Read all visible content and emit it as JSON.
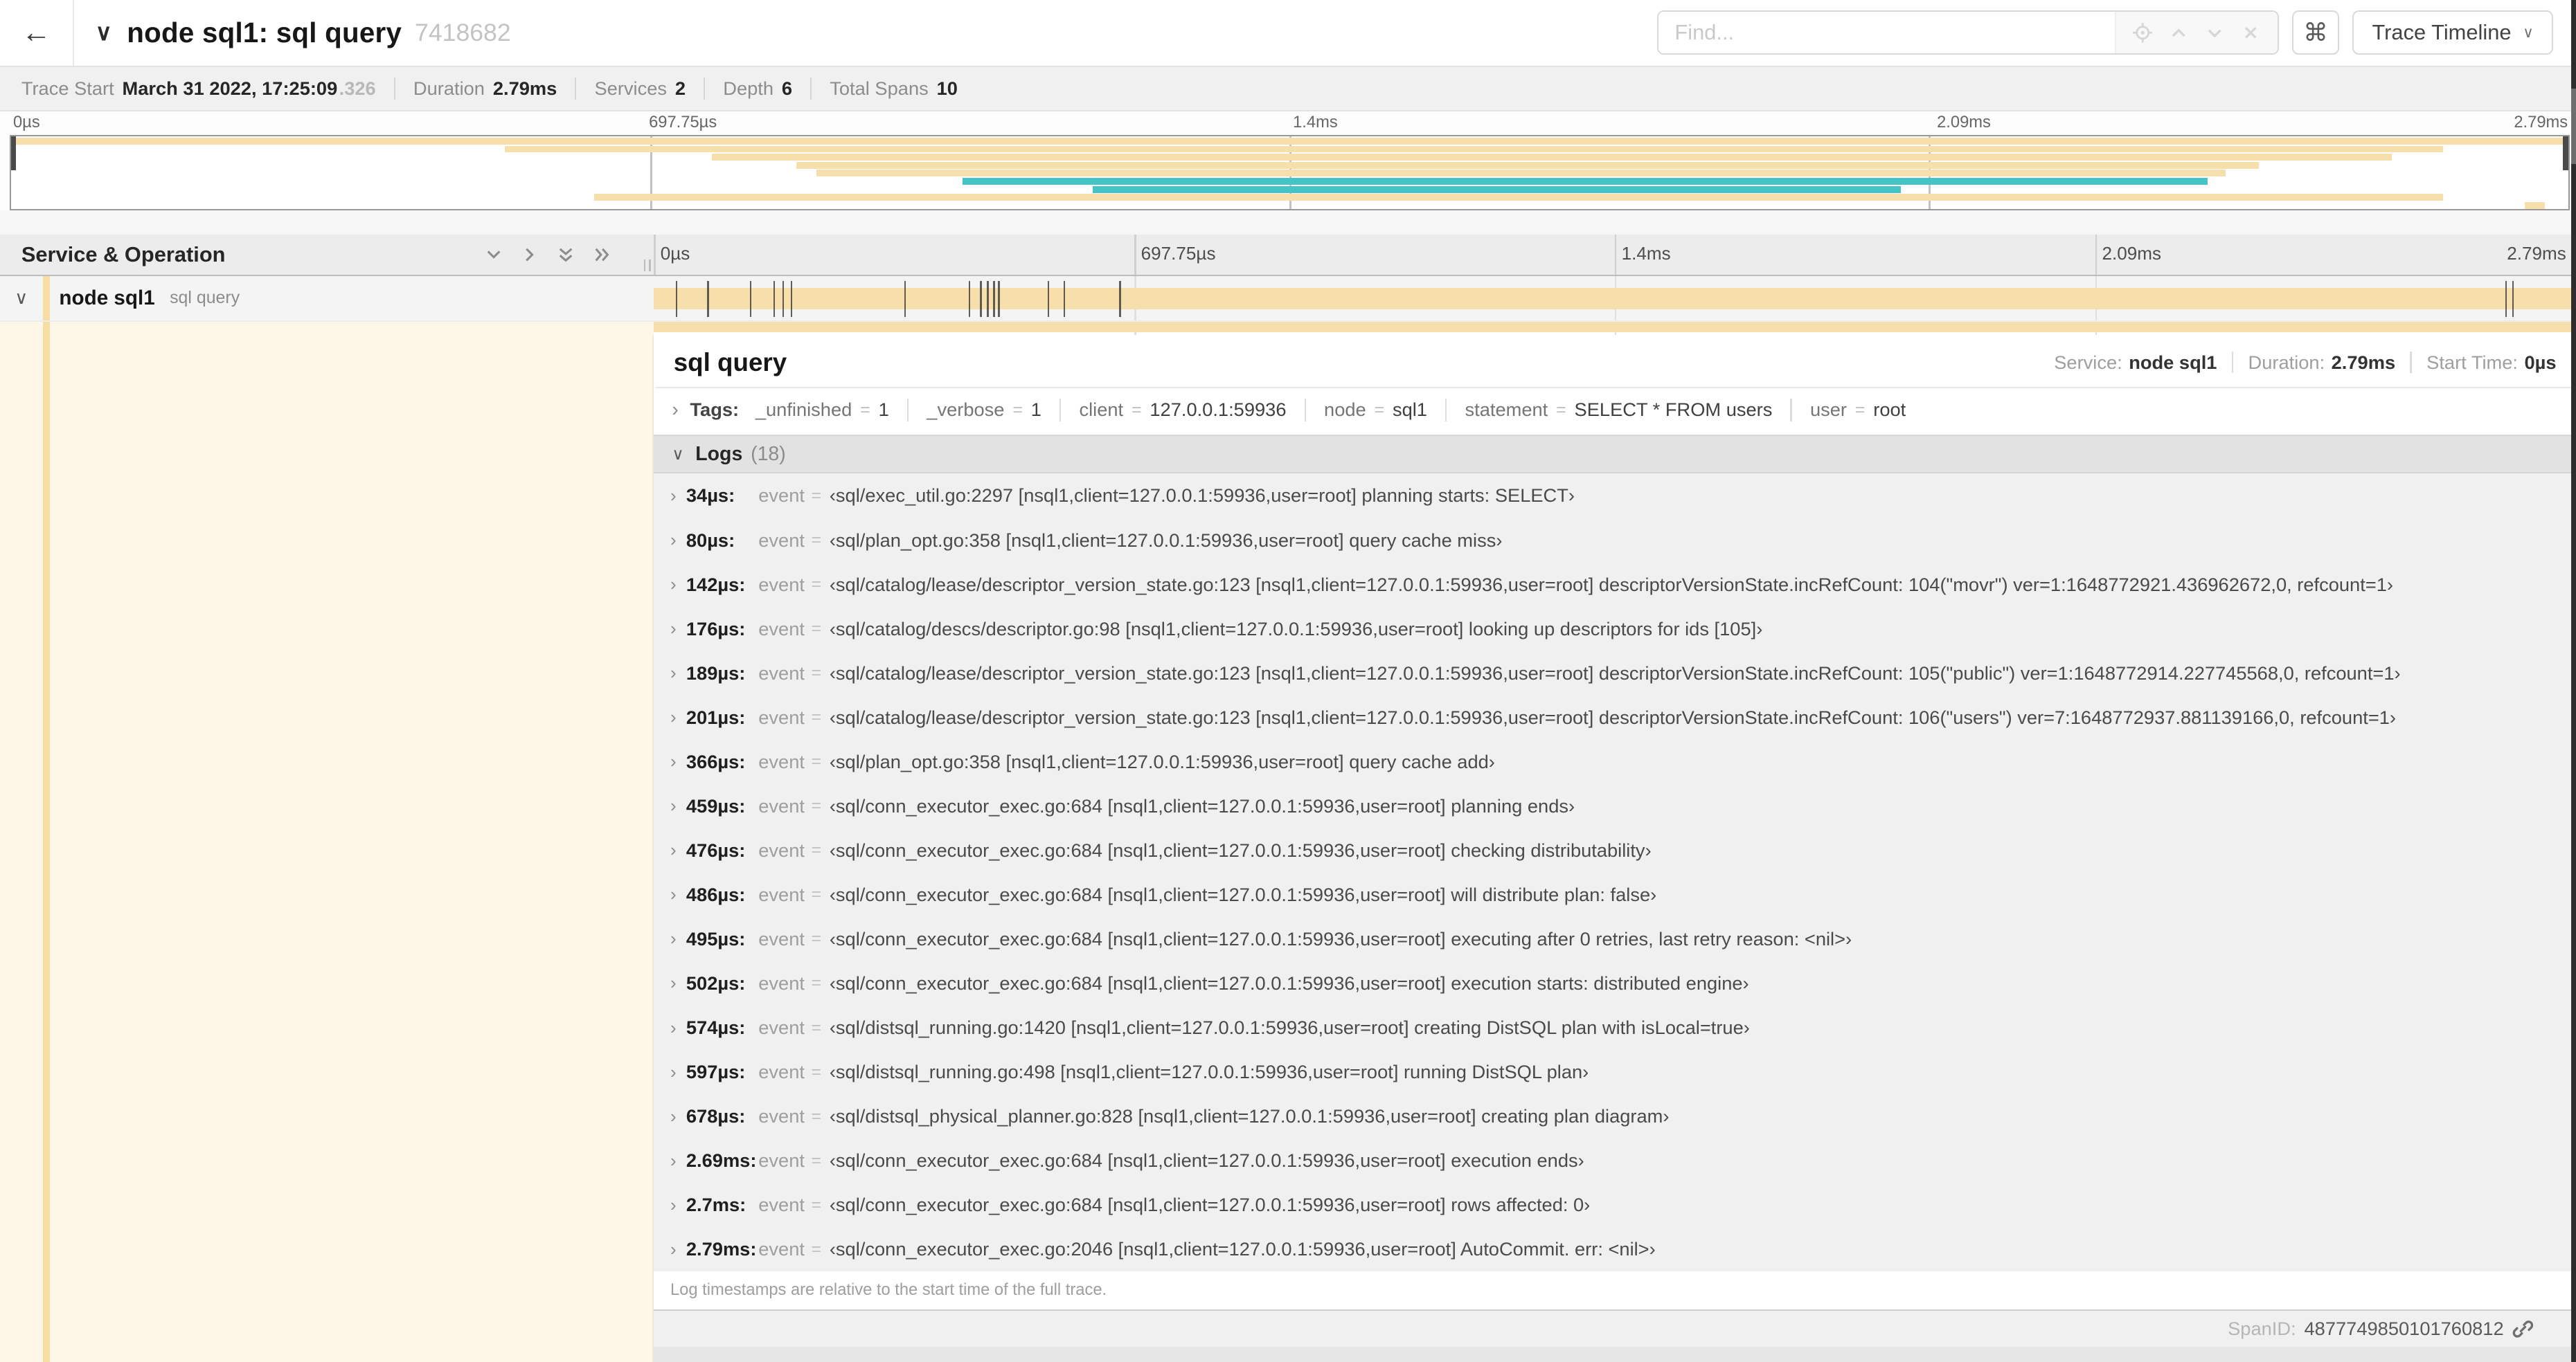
{
  "header": {
    "back": "←",
    "collapse_chevron": "∨",
    "title": "node sql1: sql query",
    "trace_id": "7418682",
    "find_placeholder": "Find...",
    "shortcut_key": "⌘",
    "view_selector": "Trace Timeline",
    "view_selector_caret": "∨"
  },
  "stats": [
    {
      "label": "Trace Start",
      "value": "March 31 2022, 17:25:09",
      "suffix": ".326"
    },
    {
      "label": "Duration",
      "value": "2.79ms",
      "suffix": ""
    },
    {
      "label": "Services",
      "value": "2",
      "suffix": ""
    },
    {
      "label": "Depth",
      "value": "6",
      "suffix": ""
    },
    {
      "label": "Total Spans",
      "value": "10",
      "suffix": ""
    }
  ],
  "timeline": {
    "ticks": [
      "0µs",
      "697.75µs",
      "1.4ms",
      "2.09ms",
      "2.79ms"
    ],
    "duration_us": 2790
  },
  "minimap": {
    "bars": [
      {
        "row": 0,
        "start": 0.0,
        "end": 1.0,
        "color": "tan"
      },
      {
        "row": 1,
        "start": 0.193,
        "end": 0.951,
        "color": "tan"
      },
      {
        "row": 2,
        "start": 0.274,
        "end": 0.931,
        "color": "tan"
      },
      {
        "row": 3,
        "start": 0.307,
        "end": 0.879,
        "color": "tan"
      },
      {
        "row": 4,
        "start": 0.315,
        "end": 0.866,
        "color": "tan"
      },
      {
        "row": 5,
        "start": 0.372,
        "end": 0.859,
        "color": "teal"
      },
      {
        "row": 6,
        "start": 0.423,
        "end": 0.739,
        "color": "teal"
      },
      {
        "row": 7,
        "start": 0.228,
        "end": 0.951,
        "color": "tan"
      },
      {
        "row": 8,
        "start": 0.983,
        "end": 0.991,
        "color": "tan"
      }
    ]
  },
  "service_operation": {
    "header": "Service & Operation"
  },
  "row": {
    "caret": "∨",
    "service": "node sql1",
    "operation": "sql query"
  },
  "detail": {
    "title": "sql query",
    "meta": [
      {
        "label": "Service:",
        "value": "node sql1"
      },
      {
        "label": "Duration:",
        "value": "2.79ms"
      },
      {
        "label": "Start Time:",
        "value": "0µs"
      }
    ],
    "tags_label": "Tags:",
    "tags": [
      {
        "key": "_unfinished",
        "value": "1"
      },
      {
        "key": "_verbose",
        "value": "1"
      },
      {
        "key": "client",
        "value": "127.0.0.1:59936"
      },
      {
        "key": "node",
        "value": "sql1"
      },
      {
        "key": "statement",
        "value": "SELECT * FROM users"
      },
      {
        "key": "user",
        "value": "root"
      }
    ],
    "logs_label": "Logs",
    "logs_count": "(18)",
    "log_field": "event",
    "log_context": "[nsql1,client=127.0.0.1:59936,user=root]",
    "logs": [
      {
        "t": "34µs:",
        "t_us": 34,
        "file": "sql/exec_util.go:2297",
        "msg": "planning starts: SELECT"
      },
      {
        "t": "80µs:",
        "t_us": 80,
        "file": "sql/plan_opt.go:358",
        "msg": "query cache miss"
      },
      {
        "t": "142µs:",
        "t_us": 142,
        "file": "sql/catalog/lease/descriptor_version_state.go:123",
        "msg": "descriptorVersionState.incRefCount: 104(\"movr\") ver=1:1648772921.436962672,0, refcount=1"
      },
      {
        "t": "176µs:",
        "t_us": 176,
        "file": "sql/catalog/descs/descriptor.go:98",
        "msg": "looking up descriptors for ids [105]"
      },
      {
        "t": "189µs:",
        "t_us": 189,
        "file": "sql/catalog/lease/descriptor_version_state.go:123",
        "msg": "descriptorVersionState.incRefCount: 105(\"public\") ver=1:1648772914.227745568,0, refcount=1"
      },
      {
        "t": "201µs:",
        "t_us": 201,
        "file": "sql/catalog/lease/descriptor_version_state.go:123",
        "msg": "descriptorVersionState.incRefCount: 106(\"users\") ver=7:1648772937.881139166,0, refcount=1"
      },
      {
        "t": "366µs:",
        "t_us": 366,
        "file": "sql/plan_opt.go:358",
        "msg": "query cache add"
      },
      {
        "t": "459µs:",
        "t_us": 459,
        "file": "sql/conn_executor_exec.go:684",
        "msg": "planning ends"
      },
      {
        "t": "476µs:",
        "t_us": 476,
        "file": "sql/conn_executor_exec.go:684",
        "msg": "checking distributability"
      },
      {
        "t": "486µs:",
        "t_us": 486,
        "file": "sql/conn_executor_exec.go:684",
        "msg": "will distribute plan: false"
      },
      {
        "t": "495µs:",
        "t_us": 495,
        "file": "sql/conn_executor_exec.go:684",
        "msg": "executing after 0 retries, last retry reason: <nil>"
      },
      {
        "t": "502µs:",
        "t_us": 502,
        "file": "sql/conn_executor_exec.go:684",
        "msg": "execution starts: distributed engine"
      },
      {
        "t": "574µs:",
        "t_us": 574,
        "file": "sql/distsql_running.go:1420",
        "msg": "creating DistSQL plan with isLocal=true"
      },
      {
        "t": "597µs:",
        "t_us": 597,
        "file": "sql/distsql_running.go:498",
        "msg": "running DistSQL plan"
      },
      {
        "t": "678µs:",
        "t_us": 678,
        "file": "sql/distsql_physical_planner.go:828",
        "msg": "creating plan diagram"
      },
      {
        "t": "2.69ms:",
        "t_us": 2690,
        "file": "sql/conn_executor_exec.go:684",
        "msg": "execution ends"
      },
      {
        "t": "2.7ms:",
        "t_us": 2700,
        "file": "sql/conn_executor_exec.go:684",
        "msg": "rows affected: 0"
      },
      {
        "t": "2.79ms:",
        "t_us": 2790,
        "file": "sql/conn_executor_exec.go:2046",
        "msg": "AutoCommit. err: <nil>"
      }
    ],
    "footer_note": "Log timestamps are relative to the start time of the full trace.",
    "span_id_label": "SpanID:",
    "span_id": "4877749850101760812"
  },
  "colors": {
    "tan": "#F6DFAB",
    "teal": "#45C4C6",
    "cream": "#FDF7E8",
    "strip": "#F5DDA4"
  }
}
